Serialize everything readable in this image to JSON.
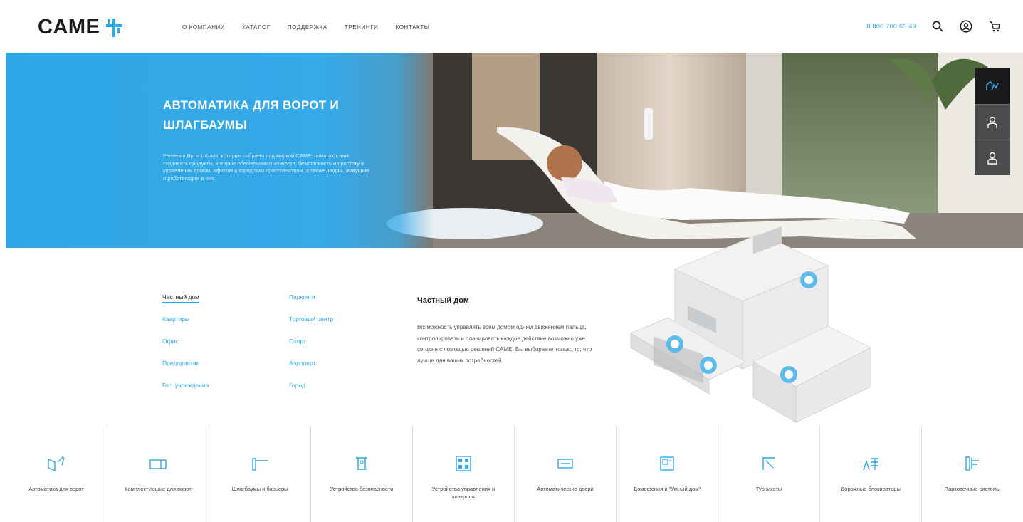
{
  "brand": {
    "logo_text": "CAME",
    "accent": "#2ea8e6"
  },
  "header": {
    "nav": [
      "О КОМПАНИИ",
      "КАТАЛОГ",
      "ПОДДЕРЖКА",
      "ТРЕНИНГИ",
      "КОНТАКТЫ"
    ],
    "phone": "8 800 700 65 49",
    "icons": [
      "search-icon",
      "user-icon",
      "cart-icon"
    ]
  },
  "hero": {
    "title": "АВТОМАТИКА ДЛЯ ВОРОТ И ШЛАГБАУМЫ",
    "text": "Решения Bpt и Urbaco, которые собраны под маркой CAME, помогают нам создавать продукты, которые обеспечивают комфорт, безопасность и простоту в управлении домом, офисом и городским пространством, а также людям, живущим и работающим в них.",
    "side_tabs": [
      {
        "icon": "home-automation-icon",
        "active": true
      },
      {
        "icon": "person-icon",
        "active": false
      },
      {
        "icon": "person-icon",
        "active": false
      }
    ]
  },
  "segments": {
    "left": [
      "Частный дом",
      "Квартиры",
      "Офис",
      "Предприятия",
      "Гос. учреждения"
    ],
    "right": [
      "Паркинги",
      "Торговый центр",
      "Спорт",
      "Аэропорт",
      "Город"
    ],
    "active": "Частный дом",
    "detail": {
      "title": "Частный дом",
      "text": "Возможность управлять всем домом одним движением пальца, контролировать и планировать каждое действие возможно уже сегодня с помощью решений CAME. Вы выбираете только то, что лучше для ваших потребностей."
    }
  },
  "products": [
    {
      "label": "Автоматика для ворот",
      "icon": "gate-automation-icon"
    },
    {
      "label": "Комплектующие для ворот",
      "icon": "gate-parts-icon"
    },
    {
      "label": "Шлагбаумы и барьеры",
      "icon": "barrier-icon"
    },
    {
      "label": "Устройства безопасности",
      "icon": "safety-device-icon"
    },
    {
      "label": "Устройства управления и контроля",
      "icon": "control-panel-icon"
    },
    {
      "label": "Автоматические двери",
      "icon": "automatic-door-icon"
    },
    {
      "label": "Домофония и \"Умный дом\"",
      "icon": "intercom-icon"
    },
    {
      "label": "Турникеты",
      "icon": "turnstile-icon"
    },
    {
      "label": "Дорожные блокираторы",
      "icon": "road-blocker-icon"
    },
    {
      "label": "Парковочные системы",
      "icon": "parking-system-icon"
    }
  ]
}
